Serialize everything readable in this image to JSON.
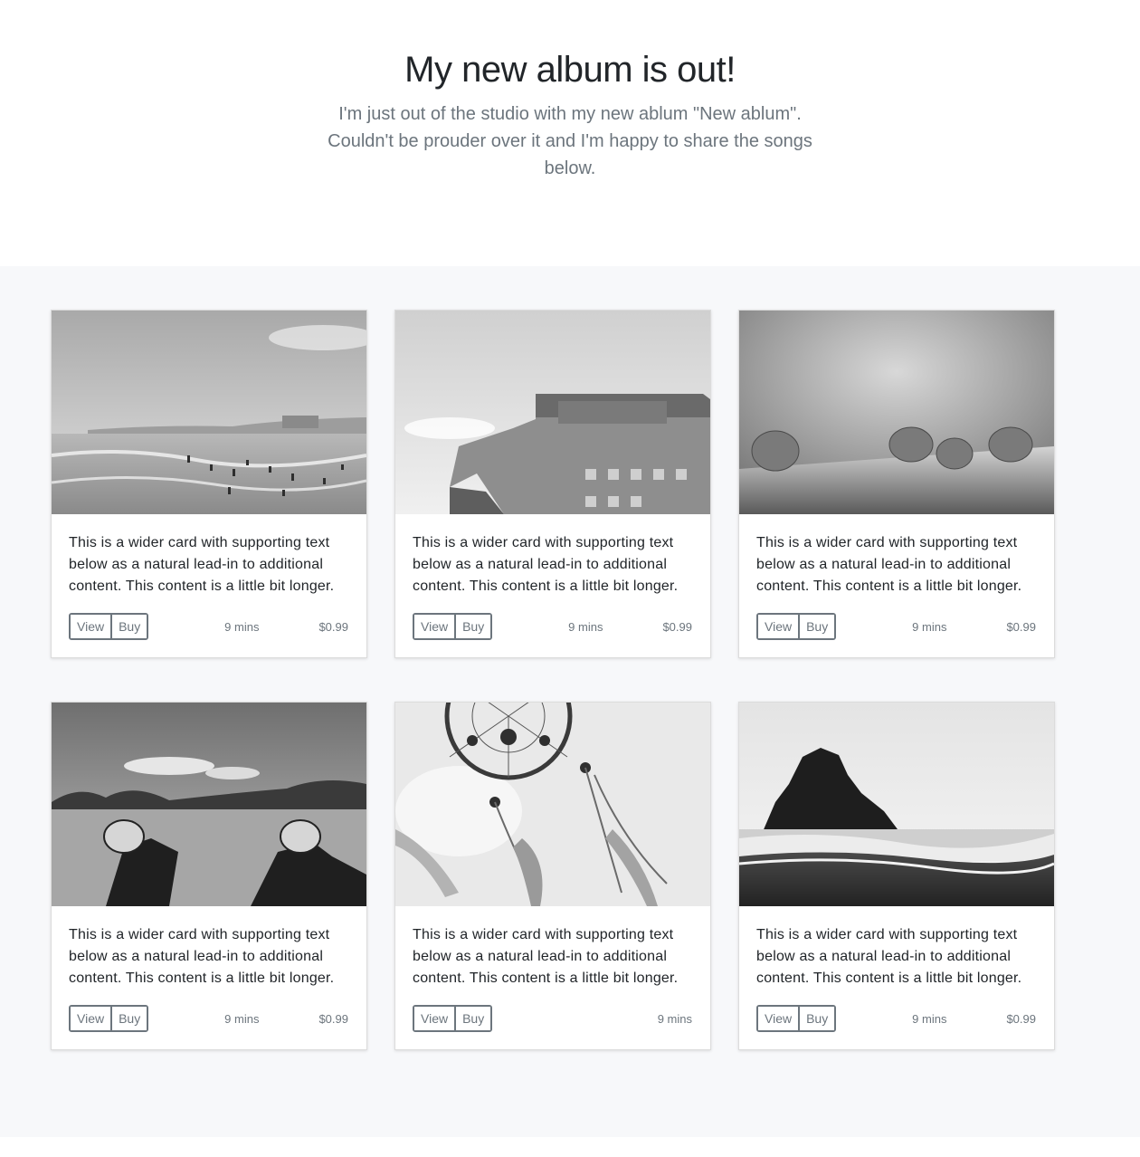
{
  "hero": {
    "title": "My new album is out!",
    "subtitle": "I'm just out of the studio with my new ablum \"New ablum\". Couldn't be prouder over it and I'm happy to share the songs below."
  },
  "cards": [
    {
      "image": "beach-photo",
      "text": "This is a wider card with supporting text below as a natural lead-in to additional content. This content is a little bit longer.",
      "view_label": "View",
      "buy_label": "Buy",
      "duration": "9 mins",
      "price": "$0.99"
    },
    {
      "image": "building-photo",
      "text": "This is a wider card with supporting text below as a natural lead-in to additional content. This content is a little bit longer.",
      "view_label": "View",
      "buy_label": "Buy",
      "duration": "9 mins",
      "price": "$0.99"
    },
    {
      "image": "raspberries-photo",
      "text": "This is a wider card with supporting text below as a natural lead-in to additional content. This content is a little bit longer.",
      "view_label": "View",
      "buy_label": "Buy",
      "duration": "9 mins",
      "price": "$0.99"
    },
    {
      "image": "field-shoes-photo",
      "text": "This is a wider card with supporting text below as a natural lead-in to additional content. This content is a little bit longer.",
      "view_label": "View",
      "buy_label": "Buy",
      "duration": "9 mins",
      "price": "$0.99"
    },
    {
      "image": "dreamcatcher-photo",
      "text": "This is a wider card with supporting text below as a natural lead-in to additional content. This content is a little bit longer.",
      "view_label": "View",
      "buy_label": "Buy",
      "duration": "9 mins",
      "price": ""
    },
    {
      "image": "sea-rock-photo",
      "text": "This is a wider card with supporting text below as a natural lead-in to additional content. This content is a little bit longer.",
      "view_label": "View",
      "buy_label": "Buy",
      "duration": "9 mins",
      "price": "$0.99"
    }
  ]
}
